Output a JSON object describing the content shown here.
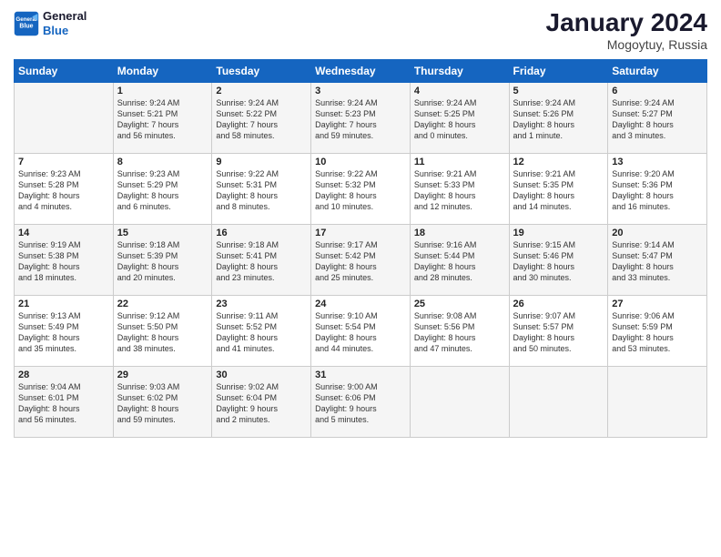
{
  "header": {
    "logo_line1": "General",
    "logo_line2": "Blue",
    "month": "January 2024",
    "location": "Mogoytuy, Russia"
  },
  "days_of_week": [
    "Sunday",
    "Monday",
    "Tuesday",
    "Wednesday",
    "Thursday",
    "Friday",
    "Saturday"
  ],
  "weeks": [
    [
      {
        "day": "",
        "text": ""
      },
      {
        "day": "1",
        "text": "Sunrise: 9:24 AM\nSunset: 5:21 PM\nDaylight: 7 hours\nand 56 minutes."
      },
      {
        "day": "2",
        "text": "Sunrise: 9:24 AM\nSunset: 5:22 PM\nDaylight: 7 hours\nand 58 minutes."
      },
      {
        "day": "3",
        "text": "Sunrise: 9:24 AM\nSunset: 5:23 PM\nDaylight: 7 hours\nand 59 minutes."
      },
      {
        "day": "4",
        "text": "Sunrise: 9:24 AM\nSunset: 5:25 PM\nDaylight: 8 hours\nand 0 minutes."
      },
      {
        "day": "5",
        "text": "Sunrise: 9:24 AM\nSunset: 5:26 PM\nDaylight: 8 hours\nand 1 minute."
      },
      {
        "day": "6",
        "text": "Sunrise: 9:24 AM\nSunset: 5:27 PM\nDaylight: 8 hours\nand 3 minutes."
      }
    ],
    [
      {
        "day": "7",
        "text": "Sunrise: 9:23 AM\nSunset: 5:28 PM\nDaylight: 8 hours\nand 4 minutes."
      },
      {
        "day": "8",
        "text": "Sunrise: 9:23 AM\nSunset: 5:29 PM\nDaylight: 8 hours\nand 6 minutes."
      },
      {
        "day": "9",
        "text": "Sunrise: 9:22 AM\nSunset: 5:31 PM\nDaylight: 8 hours\nand 8 minutes."
      },
      {
        "day": "10",
        "text": "Sunrise: 9:22 AM\nSunset: 5:32 PM\nDaylight: 8 hours\nand 10 minutes."
      },
      {
        "day": "11",
        "text": "Sunrise: 9:21 AM\nSunset: 5:33 PM\nDaylight: 8 hours\nand 12 minutes."
      },
      {
        "day": "12",
        "text": "Sunrise: 9:21 AM\nSunset: 5:35 PM\nDaylight: 8 hours\nand 14 minutes."
      },
      {
        "day": "13",
        "text": "Sunrise: 9:20 AM\nSunset: 5:36 PM\nDaylight: 8 hours\nand 16 minutes."
      }
    ],
    [
      {
        "day": "14",
        "text": "Sunrise: 9:19 AM\nSunset: 5:38 PM\nDaylight: 8 hours\nand 18 minutes."
      },
      {
        "day": "15",
        "text": "Sunrise: 9:18 AM\nSunset: 5:39 PM\nDaylight: 8 hours\nand 20 minutes."
      },
      {
        "day": "16",
        "text": "Sunrise: 9:18 AM\nSunset: 5:41 PM\nDaylight: 8 hours\nand 23 minutes."
      },
      {
        "day": "17",
        "text": "Sunrise: 9:17 AM\nSunset: 5:42 PM\nDaylight: 8 hours\nand 25 minutes."
      },
      {
        "day": "18",
        "text": "Sunrise: 9:16 AM\nSunset: 5:44 PM\nDaylight: 8 hours\nand 28 minutes."
      },
      {
        "day": "19",
        "text": "Sunrise: 9:15 AM\nSunset: 5:46 PM\nDaylight: 8 hours\nand 30 minutes."
      },
      {
        "day": "20",
        "text": "Sunrise: 9:14 AM\nSunset: 5:47 PM\nDaylight: 8 hours\nand 33 minutes."
      }
    ],
    [
      {
        "day": "21",
        "text": "Sunrise: 9:13 AM\nSunset: 5:49 PM\nDaylight: 8 hours\nand 35 minutes."
      },
      {
        "day": "22",
        "text": "Sunrise: 9:12 AM\nSunset: 5:50 PM\nDaylight: 8 hours\nand 38 minutes."
      },
      {
        "day": "23",
        "text": "Sunrise: 9:11 AM\nSunset: 5:52 PM\nDaylight: 8 hours\nand 41 minutes."
      },
      {
        "day": "24",
        "text": "Sunrise: 9:10 AM\nSunset: 5:54 PM\nDaylight: 8 hours\nand 44 minutes."
      },
      {
        "day": "25",
        "text": "Sunrise: 9:08 AM\nSunset: 5:56 PM\nDaylight: 8 hours\nand 47 minutes."
      },
      {
        "day": "26",
        "text": "Sunrise: 9:07 AM\nSunset: 5:57 PM\nDaylight: 8 hours\nand 50 minutes."
      },
      {
        "day": "27",
        "text": "Sunrise: 9:06 AM\nSunset: 5:59 PM\nDaylight: 8 hours\nand 53 minutes."
      }
    ],
    [
      {
        "day": "28",
        "text": "Sunrise: 9:04 AM\nSunset: 6:01 PM\nDaylight: 8 hours\nand 56 minutes."
      },
      {
        "day": "29",
        "text": "Sunrise: 9:03 AM\nSunset: 6:02 PM\nDaylight: 8 hours\nand 59 minutes."
      },
      {
        "day": "30",
        "text": "Sunrise: 9:02 AM\nSunset: 6:04 PM\nDaylight: 9 hours\nand 2 minutes."
      },
      {
        "day": "31",
        "text": "Sunrise: 9:00 AM\nSunset: 6:06 PM\nDaylight: 9 hours\nand 5 minutes."
      },
      {
        "day": "",
        "text": ""
      },
      {
        "day": "",
        "text": ""
      },
      {
        "day": "",
        "text": ""
      }
    ]
  ]
}
